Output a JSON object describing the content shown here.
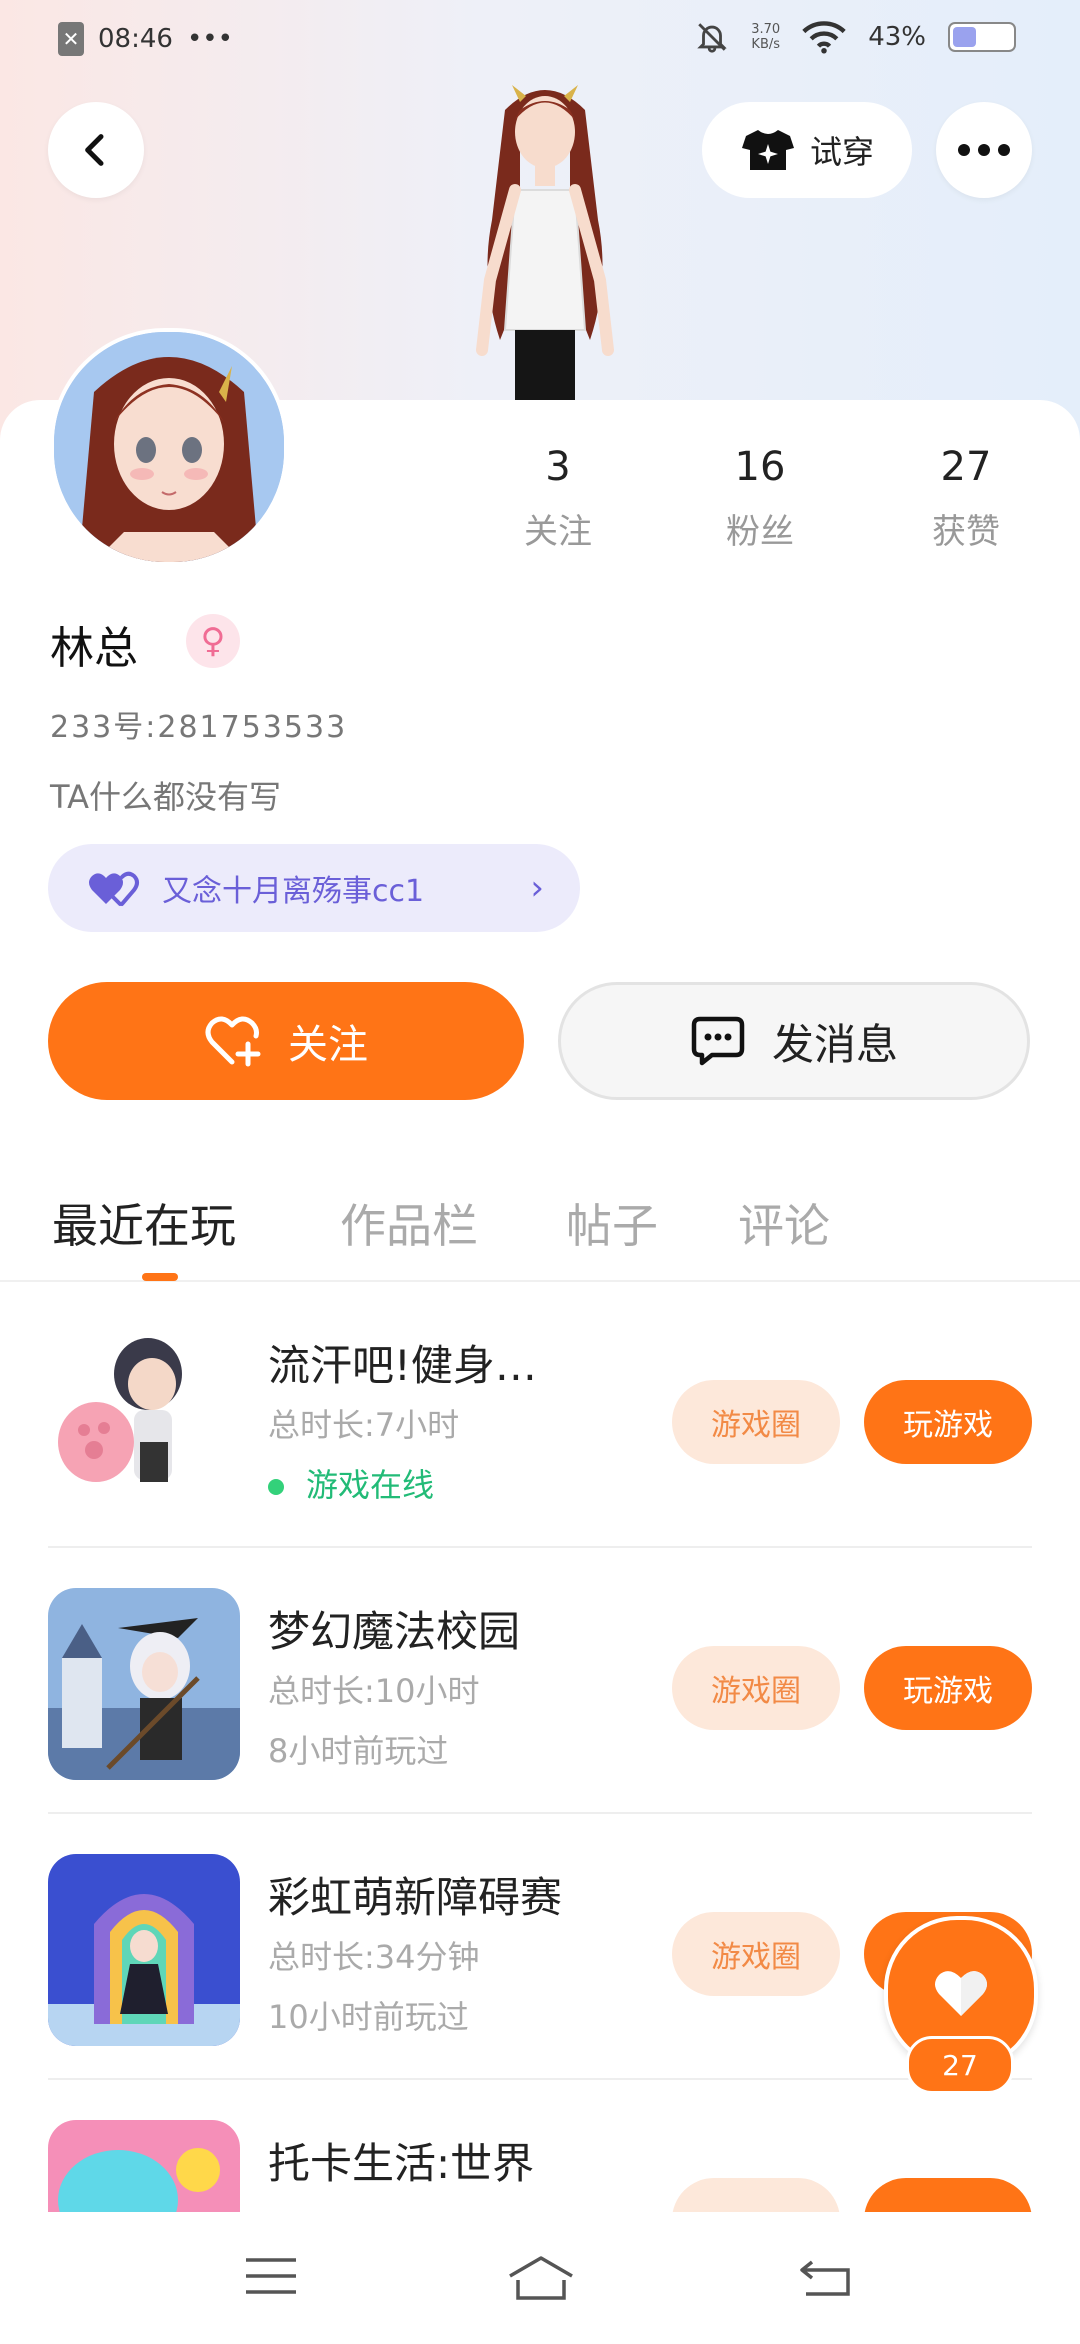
{
  "status_bar": {
    "time": "08:46",
    "dots": "•••",
    "net_speed_value": "3.70",
    "net_speed_unit": "KB/s",
    "battery_percent": "43%",
    "battery_level": 0.43
  },
  "header": {
    "tryon_label": "试穿"
  },
  "profile": {
    "name": "林总",
    "gender_symbol": "♀",
    "uid": "233号:281753533",
    "bio": "TA什么都没有写",
    "stats": [
      {
        "value": "3",
        "label": "关注"
      },
      {
        "value": "16",
        "label": "粉丝"
      },
      {
        "value": "27",
        "label": "获赞"
      }
    ],
    "tag_text": "又念十月离殇事cc1"
  },
  "actions": {
    "follow_label": "关注",
    "message_label": "发消息"
  },
  "tabs": [
    {
      "label": "最近在玩",
      "active": true
    },
    {
      "label": "作品栏",
      "active": false
    },
    {
      "label": "帖子",
      "active": false
    },
    {
      "label": "评论",
      "active": false
    }
  ],
  "games": [
    {
      "title": "流汗吧!健身…",
      "duration": "总时长:7小时",
      "status": "游戏在线",
      "online": true,
      "circle_label": "游戏圈",
      "play_label": "玩游戏"
    },
    {
      "title": "梦幻魔法校园",
      "duration": "总时长:10小时",
      "status": "8小时前玩过",
      "online": false,
      "circle_label": "游戏圈",
      "play_label": "玩游戏"
    },
    {
      "title": "彩虹萌新障碍赛",
      "duration": "总时长:34分钟",
      "status": "10小时前玩过",
      "online": false,
      "circle_label": "游戏圈",
      "play_label": "玩游戏"
    },
    {
      "title": "托卡生活:世界",
      "duration": "",
      "status": "",
      "online": false,
      "circle_label": "",
      "play_label": ""
    }
  ],
  "floating_like": {
    "count": "27"
  },
  "colors": {
    "accent": "#ff7416",
    "tag_bg": "#ecebfb",
    "online": "#22bb77"
  }
}
